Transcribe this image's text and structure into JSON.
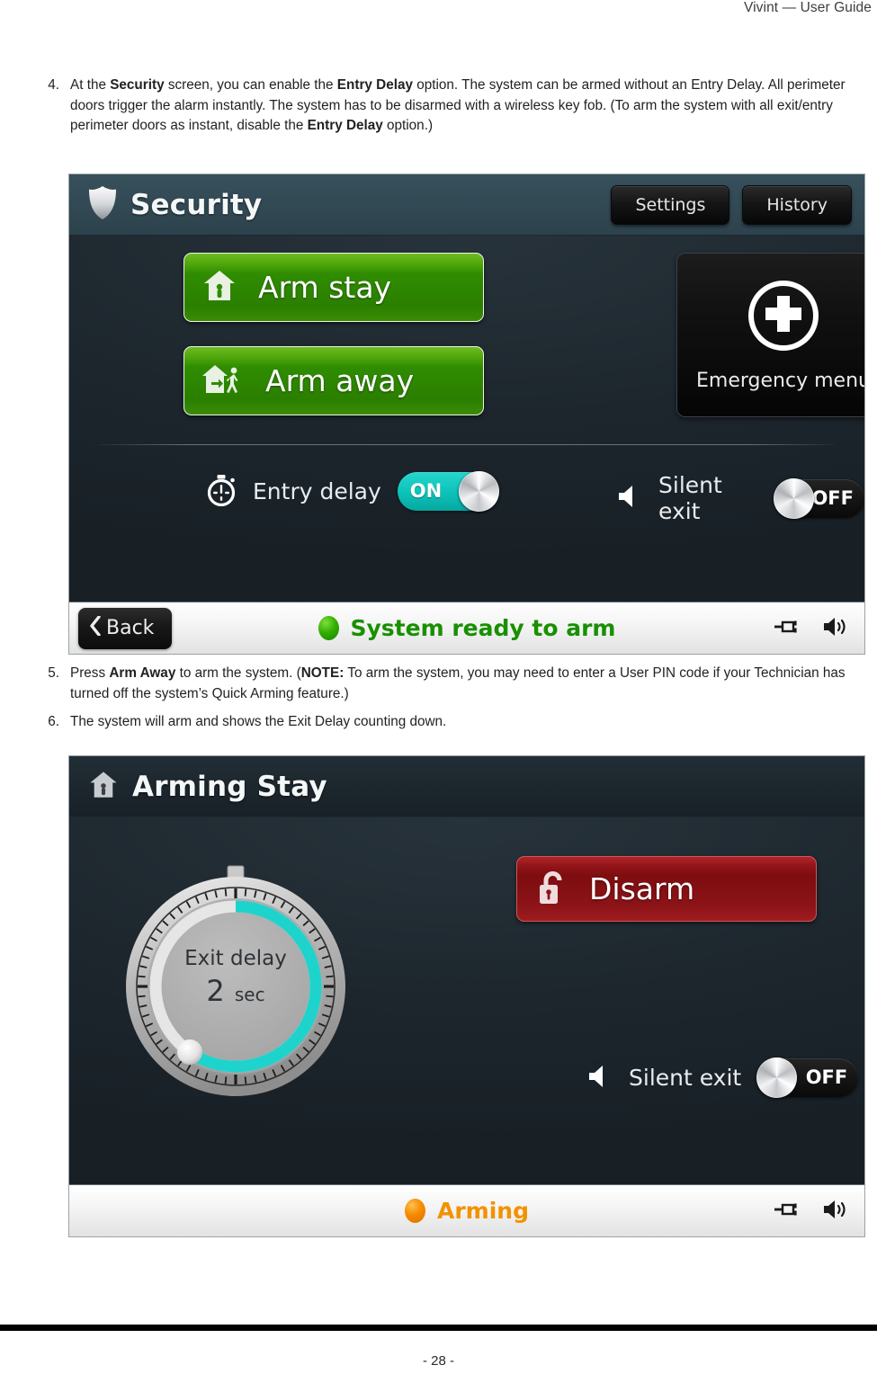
{
  "header": {
    "title": "Vivint — User Guide"
  },
  "steps": [
    {
      "num": "4.",
      "runs": [
        {
          "t": "At the ",
          "b": false
        },
        {
          "t": "Security",
          "b": true
        },
        {
          "t": " screen, you can enable the ",
          "b": false
        },
        {
          "t": "Entry Delay",
          "b": true
        },
        {
          "t": " option. The system can be armed without an Entry Delay. All perimeter doors trigger the alarm instantly. The system has to be disarmed with a wireless key fob. (To arm the system with all exit/entry perimeter doors as instant, disable the ",
          "b": false
        },
        {
          "t": "Entry Delay",
          "b": true
        },
        {
          "t": " option.)",
          "b": false
        }
      ]
    },
    {
      "num": "5.",
      "runs": [
        {
          "t": "Press ",
          "b": false
        },
        {
          "t": "Arm Away",
          "b": true
        },
        {
          "t": " to arm the system. (",
          "b": false
        },
        {
          "t": "NOTE:",
          "b": true
        },
        {
          "t": " To arm the system, you may need to enter a User PIN code if your Technician has turned off the system’s Quick Arming feature.)",
          "b": false
        }
      ]
    },
    {
      "num": "6.",
      "runs": [
        {
          "t": "The system will arm and shows the Exit Delay counting down.",
          "b": false
        }
      ]
    }
  ],
  "security_screen": {
    "title": "Security",
    "title_icon": "shield-icon",
    "settings_label": "Settings",
    "history_label": "History",
    "arm_stay_label": "Arm stay",
    "arm_stay_icon": "house-person-icon",
    "arm_away_label": "Arm away",
    "arm_away_icon": "house-exit-person-icon",
    "emergency_label": "Emergency menu",
    "emergency_icon": "medical-cross-circle-icon",
    "entry_delay": {
      "label": "Entry delay",
      "icon": "stopwatch-icon",
      "state": "ON"
    },
    "silent_exit": {
      "label": "Silent exit",
      "icon": "speaker-mute-icon",
      "state": "OFF"
    },
    "back_label": "Back",
    "status_text": "System ready to arm",
    "status_color": "#189000",
    "status_icons": [
      "power-plug-icon",
      "speaker-volume-icon"
    ]
  },
  "arming_screen": {
    "title": "Arming Stay",
    "title_icon": "house-person-icon",
    "dial": {
      "label": "Exit delay",
      "value": "2",
      "unit": "sec",
      "arc_color": "#1fd3cd",
      "arc_start_deg": 0,
      "arc_end_deg": 215
    },
    "disarm_label": "Disarm",
    "disarm_icon": "unlocked-padlock-icon",
    "silent_exit": {
      "label": "Silent exit",
      "icon": "speaker-mute-icon",
      "state": "OFF"
    },
    "status_text": "Arming",
    "status_color": "#f29200",
    "status_icons": [
      "power-plug-icon",
      "speaker-volume-icon"
    ]
  },
  "footer": {
    "page_number": "- 28 -"
  }
}
